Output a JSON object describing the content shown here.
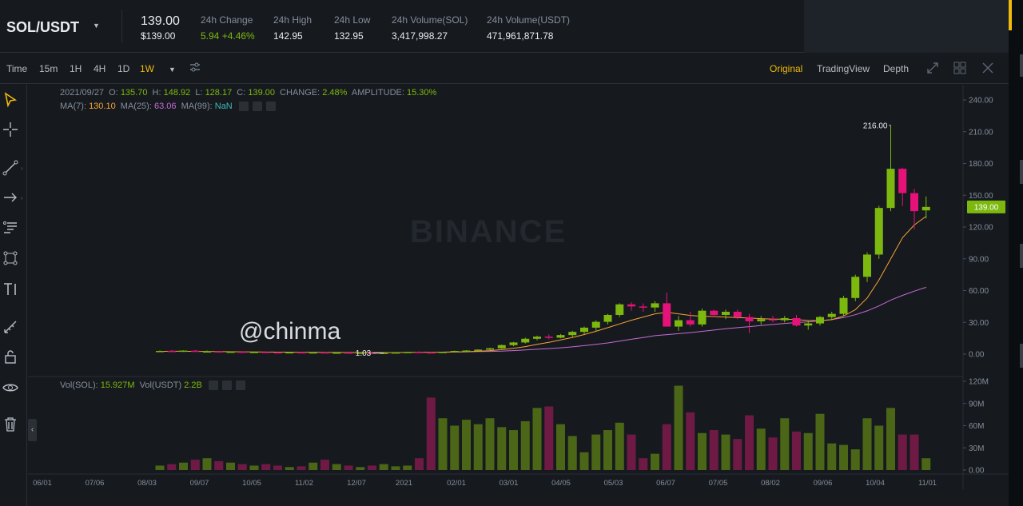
{
  "ticker": {
    "symbol": "SOL/USDT",
    "price": "139.00",
    "price_usd": "$139.00",
    "stats": [
      {
        "label": "24h Change",
        "value": "5.94 +4.46%",
        "up": true
      },
      {
        "label": "24h High",
        "value": "142.95"
      },
      {
        "label": "24h Low",
        "value": "132.95"
      },
      {
        "label": "24h Volume(SOL)",
        "value": "3,417,998.27"
      },
      {
        "label": "24h Volume(USDT)",
        "value": "471,961,871.78"
      }
    ]
  },
  "toolbar": {
    "intervals": [
      "Time",
      "15m",
      "1H",
      "4H",
      "1D",
      "1W"
    ],
    "active_interval": "1W",
    "views": [
      "Original",
      "TradingView",
      "Depth"
    ],
    "active_view": "Original"
  },
  "legend": {
    "ohlc": {
      "date": "2021/09/27",
      "o_label": "O:",
      "o": "135.70",
      "h_label": "H:",
      "h": "148.92",
      "l_label": "L:",
      "l": "128.17",
      "c_label": "C:",
      "c": "139.00",
      "change_label": "CHANGE:",
      "change": "2.48%",
      "amp_label": "AMPLITUDE:",
      "amp": "15.30%"
    },
    "ma": {
      "ma7_label": "MA(7):",
      "ma7": "130.10",
      "ma25_label": "MA(25):",
      "ma25": "63.06",
      "ma99_label": "MA(99):",
      "ma99": "NaN"
    },
    "vol": {
      "sol_label": "Vol(SOL):",
      "sol": "15.927M",
      "usdt_label": "Vol(USDT)",
      "usdt": "2.2B"
    }
  },
  "watermark": "BINANCE",
  "handle": "@chinma",
  "colors": {
    "up": "#7db80e",
    "down": "#e5127a",
    "ma7": "#f7a238",
    "ma25": "#c66bd6",
    "bg": "#161a1e",
    "accent": "#f0b90b"
  },
  "chart_data": {
    "type": "candlestick",
    "price_axis": [
      "240.00",
      "210.00",
      "180.00",
      "150.00",
      "120.00",
      "90.00",
      "60.00",
      "30.00",
      "0.00"
    ],
    "price_ylim": [
      0,
      240
    ],
    "volume_axis": [
      "120M",
      "90M",
      "60M",
      "30M",
      "0.00"
    ],
    "volume_ylim": [
      0,
      120
    ],
    "x_labels": [
      "06/01",
      "07/06",
      "08/03",
      "09/07",
      "10/05",
      "11/02",
      "12/07",
      "2021",
      "02/01",
      "03/01",
      "04/05",
      "05/03",
      "06/07",
      "07/05",
      "08/02",
      "09/06",
      "10/04",
      "11/01"
    ],
    "last_price_label": "139.00",
    "high_label": "216.00",
    "low_label": "1.03",
    "candles": [
      {
        "o": 2.5,
        "h": 3.5,
        "l": 2.0,
        "c": 3.0
      },
      {
        "o": 3.0,
        "h": 3.8,
        "l": 2.3,
        "c": 2.4
      },
      {
        "o": 2.4,
        "h": 3.6,
        "l": 2.2,
        "c": 3.3
      },
      {
        "o": 3.3,
        "h": 3.9,
        "l": 2.4,
        "c": 2.5
      },
      {
        "o": 2.5,
        "h": 3.4,
        "l": 2.3,
        "c": 2.6
      },
      {
        "o": 2.6,
        "h": 3.0,
        "l": 2.0,
        "c": 2.1
      },
      {
        "o": 2.1,
        "h": 2.6,
        "l": 1.8,
        "c": 2.3
      },
      {
        "o": 2.3,
        "h": 2.6,
        "l": 1.8,
        "c": 1.9
      },
      {
        "o": 1.9,
        "h": 2.3,
        "l": 1.6,
        "c": 2.1
      },
      {
        "o": 2.1,
        "h": 2.4,
        "l": 1.7,
        "c": 1.8
      },
      {
        "o": 1.8,
        "h": 2.2,
        "l": 1.5,
        "c": 1.6
      },
      {
        "o": 1.6,
        "h": 2.0,
        "l": 1.4,
        "c": 1.8
      },
      {
        "o": 1.8,
        "h": 2.0,
        "l": 1.4,
        "c": 1.5
      },
      {
        "o": 1.5,
        "h": 1.9,
        "l": 1.3,
        "c": 1.7
      },
      {
        "o": 1.7,
        "h": 1.9,
        "l": 1.3,
        "c": 1.4
      },
      {
        "o": 1.4,
        "h": 1.7,
        "l": 1.2,
        "c": 1.5
      },
      {
        "o": 1.5,
        "h": 1.6,
        "l": 1.1,
        "c": 1.2
      },
      {
        "o": 1.2,
        "h": 1.5,
        "l": 1.1,
        "c": 1.4
      },
      {
        "o": 1.4,
        "h": 1.6,
        "l": 1.1,
        "c": 1.2
      },
      {
        "o": 1.2,
        "h": 1.5,
        "l": 1.0,
        "c": 1.3
      },
      {
        "o": 1.3,
        "h": 1.7,
        "l": 1.1,
        "c": 1.6
      },
      {
        "o": 1.6,
        "h": 2.2,
        "l": 1.4,
        "c": 2.0
      },
      {
        "o": 2.0,
        "h": 2.6,
        "l": 1.6,
        "c": 1.7
      },
      {
        "o": 1.7,
        "h": 2.2,
        "l": 1.03,
        "c": 1.5
      },
      {
        "o": 1.5,
        "h": 2.3,
        "l": 1.4,
        "c": 2.1
      },
      {
        "o": 2.1,
        "h": 3.3,
        "l": 1.9,
        "c": 3.0
      },
      {
        "o": 3.0,
        "h": 3.8,
        "l": 2.6,
        "c": 3.4
      },
      {
        "o": 3.4,
        "h": 4.5,
        "l": 3.0,
        "c": 4.2
      },
      {
        "o": 4.2,
        "h": 6.0,
        "l": 3.8,
        "c": 5.5
      },
      {
        "o": 5.5,
        "h": 9.0,
        "l": 5.0,
        "c": 8.5
      },
      {
        "o": 8.5,
        "h": 11.5,
        "l": 7.5,
        "c": 11.0
      },
      {
        "o": 11.0,
        "h": 15.5,
        "l": 10.0,
        "c": 14.5
      },
      {
        "o": 14.5,
        "h": 17.5,
        "l": 13.0,
        "c": 16.5
      },
      {
        "o": 16.5,
        "h": 18.5,
        "l": 14.0,
        "c": 15.5
      },
      {
        "o": 15.5,
        "h": 19.0,
        "l": 15.0,
        "c": 18.0
      },
      {
        "o": 18.0,
        "h": 22.0,
        "l": 16.0,
        "c": 21.0
      },
      {
        "o": 21.0,
        "h": 26.0,
        "l": 19.0,
        "c": 25.0
      },
      {
        "o": 25.0,
        "h": 32.0,
        "l": 22.0,
        "c": 30.5
      },
      {
        "o": 30.5,
        "h": 38.0,
        "l": 28.0,
        "c": 37.0
      },
      {
        "o": 37.0,
        "h": 48.0,
        "l": 35.0,
        "c": 47.0
      },
      {
        "o": 47.0,
        "h": 49.0,
        "l": 41.0,
        "c": 45.0
      },
      {
        "o": 45.0,
        "h": 48.0,
        "l": 40.0,
        "c": 44.0
      },
      {
        "o": 44.0,
        "h": 50.0,
        "l": 40.0,
        "c": 48.0
      },
      {
        "o": 48.0,
        "h": 58.0,
        "l": 35.0,
        "c": 26.0
      },
      {
        "o": 26.0,
        "h": 36.0,
        "l": 22.0,
        "c": 32.0
      },
      {
        "o": 32.0,
        "h": 40.0,
        "l": 26.0,
        "c": 28.0
      },
      {
        "o": 28.0,
        "h": 43.0,
        "l": 26.0,
        "c": 41.0
      },
      {
        "o": 41.0,
        "h": 42.0,
        "l": 35.0,
        "c": 37.0
      },
      {
        "o": 37.0,
        "h": 42.0,
        "l": 33.0,
        "c": 40.0
      },
      {
        "o": 40.0,
        "h": 42.0,
        "l": 33.0,
        "c": 35.0
      },
      {
        "o": 35.0,
        "h": 38.0,
        "l": 20.0,
        "c": 31.0
      },
      {
        "o": 31.0,
        "h": 36.0,
        "l": 28.0,
        "c": 33.0
      },
      {
        "o": 33.0,
        "h": 36.0,
        "l": 30.0,
        "c": 32.0
      },
      {
        "o": 32.0,
        "h": 36.0,
        "l": 30.0,
        "c": 34.0
      },
      {
        "o": 34.0,
        "h": 37.0,
        "l": 26.0,
        "c": 27.0
      },
      {
        "o": 27.0,
        "h": 32.0,
        "l": 23.0,
        "c": 29.0
      },
      {
        "o": 29.0,
        "h": 36.0,
        "l": 27.0,
        "c": 35.0
      },
      {
        "o": 35.0,
        "h": 40.0,
        "l": 32.0,
        "c": 38.0
      },
      {
        "o": 38.0,
        "h": 55.0,
        "l": 36.0,
        "c": 53.0
      },
      {
        "o": 53.0,
        "h": 75.0,
        "l": 50.0,
        "c": 73.0
      },
      {
        "o": 73.0,
        "h": 96.0,
        "l": 68.0,
        "c": 94.0
      },
      {
        "o": 94.0,
        "h": 140.0,
        "l": 90.0,
        "c": 138.0
      },
      {
        "o": 138.0,
        "h": 216.0,
        "l": 135.0,
        "c": 175.0
      },
      {
        "o": 175.0,
        "h": 176.0,
        "l": 140.0,
        "c": 152.0
      },
      {
        "o": 152.0,
        "h": 156.0,
        "l": 118.0,
        "c": 135.0
      },
      {
        "o": 135.7,
        "h": 148.92,
        "l": 128.17,
        "c": 139.0
      }
    ],
    "ma7": [
      2.6,
      2.7,
      2.7,
      2.6,
      2.5,
      2.4,
      2.3,
      2.2,
      2.1,
      2.0,
      1.9,
      1.8,
      1.7,
      1.65,
      1.6,
      1.55,
      1.5,
      1.45,
      1.4,
      1.4,
      1.45,
      1.55,
      1.65,
      1.7,
      1.8,
      2.0,
      2.3,
      2.7,
      3.3,
      4.2,
      5.4,
      7.1,
      9.3,
      11.2,
      13.4,
      15.8,
      18.5,
      21.6,
      25.0,
      28.5,
      32.0,
      35.0,
      38.0,
      39.5,
      38.0,
      36.5,
      35.8,
      35.5,
      35.0,
      34.5,
      34.0,
      33.5,
      33.0,
      33.0,
      32.5,
      31.8,
      31.5,
      32.5,
      36.0,
      42.0,
      53.0,
      70.0,
      90.0,
      110.0,
      122.0,
      130.1
    ],
    "ma25": [
      null,
      null,
      null,
      null,
      null,
      null,
      null,
      null,
      null,
      null,
      null,
      null,
      null,
      null,
      null,
      null,
      null,
      null,
      null,
      null,
      null,
      null,
      null,
      null,
      2.0,
      2.1,
      2.2,
      2.4,
      2.6,
      2.9,
      3.3,
      3.9,
      4.6,
      5.2,
      6.0,
      6.9,
      8.0,
      9.2,
      10.6,
      12.3,
      14.0,
      15.7,
      17.4,
      18.4,
      19.3,
      20.3,
      21.5,
      22.7,
      23.9,
      25.0,
      26.0,
      27.0,
      28.0,
      29.0,
      29.8,
      30.5,
      31.5,
      32.6,
      34.5,
      37.2,
      40.8,
      45.5,
      51.0,
      55.5,
      59.5,
      63.06
    ],
    "volume_m": [
      6,
      8,
      10,
      14,
      16,
      12,
      10,
      8,
      6,
      8,
      6,
      4,
      5,
      10,
      14,
      8,
      6,
      4,
      6,
      8,
      5,
      6,
      16,
      98,
      70,
      60,
      68,
      62,
      70,
      58,
      54,
      66,
      84,
      86,
      62,
      46,
      24,
      48,
      54,
      64,
      48,
      16,
      22,
      62,
      114,
      78,
      50,
      54,
      48,
      42,
      74,
      56,
      44,
      70,
      52,
      50,
      76,
      36,
      34,
      28,
      70,
      60,
      84,
      48,
      48,
      16
    ]
  }
}
